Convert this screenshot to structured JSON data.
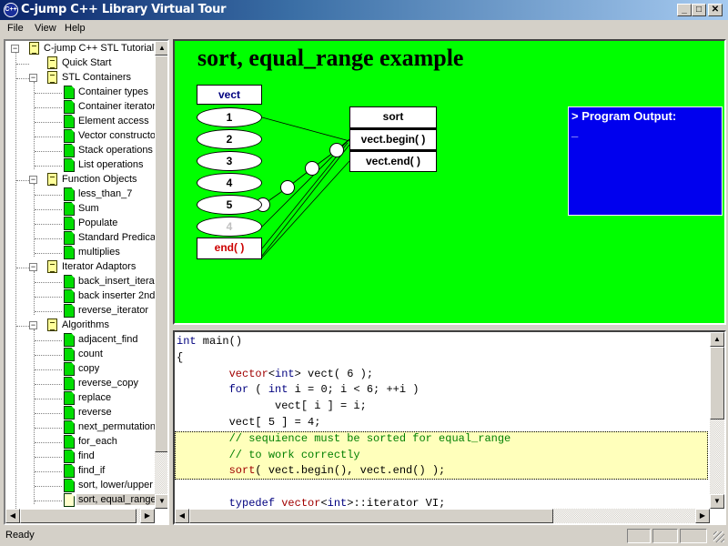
{
  "window": {
    "title": "C-jump C++ Library Virtual Tour",
    "controls": {
      "minimize": "_",
      "maximize": "□",
      "close": "✕"
    }
  },
  "menu": [
    "File",
    "View",
    "Help"
  ],
  "tree": {
    "root": "C-jump C++ STL Tutorial",
    "items": [
      {
        "label": "Quick Start",
        "type": "book",
        "level": 1
      },
      {
        "label": "STL Containers",
        "type": "book",
        "level": 1,
        "expanded": true
      },
      {
        "label": "Container types",
        "type": "page",
        "level": 2
      },
      {
        "label": "Container iterator",
        "type": "page",
        "level": 2
      },
      {
        "label": "Element access",
        "type": "page",
        "level": 2
      },
      {
        "label": "Vector constructo",
        "type": "page",
        "level": 2
      },
      {
        "label": "Stack operations",
        "type": "page",
        "level": 2
      },
      {
        "label": "List operations",
        "type": "page",
        "level": 2
      },
      {
        "label": "Function Objects",
        "type": "book",
        "level": 1,
        "expanded": true
      },
      {
        "label": "less_than_7",
        "type": "page",
        "level": 2
      },
      {
        "label": "Sum",
        "type": "page",
        "level": 2
      },
      {
        "label": "Populate",
        "type": "page",
        "level": 2
      },
      {
        "label": "Standard Predicat",
        "type": "page",
        "level": 2
      },
      {
        "label": "multiplies",
        "type": "page",
        "level": 2
      },
      {
        "label": "Iterator Adaptors",
        "type": "book",
        "level": 1,
        "expanded": true
      },
      {
        "label": "back_insert_iteral",
        "type": "page",
        "level": 2
      },
      {
        "label": "back inserter 2nd",
        "type": "page",
        "level": 2
      },
      {
        "label": "reverse_iterator",
        "type": "page",
        "level": 2
      },
      {
        "label": "Algorithms",
        "type": "book",
        "level": 1,
        "expanded": true
      },
      {
        "label": "adjacent_find",
        "type": "page",
        "level": 2
      },
      {
        "label": "count",
        "type": "page",
        "level": 2
      },
      {
        "label": "copy",
        "type": "page",
        "level": 2
      },
      {
        "label": "reverse_copy",
        "type": "page",
        "level": 2
      },
      {
        "label": "replace",
        "type": "page",
        "level": 2
      },
      {
        "label": "reverse",
        "type": "page",
        "level": 2
      },
      {
        "label": "next_permutation",
        "type": "page",
        "level": 2
      },
      {
        "label": "for_each",
        "type": "page",
        "level": 2
      },
      {
        "label": "find",
        "type": "page",
        "level": 2
      },
      {
        "label": "find_if",
        "type": "page",
        "level": 2
      },
      {
        "label": "sort, lower/upper",
        "type": "page",
        "level": 2
      },
      {
        "label": "sort, equal_range",
        "type": "current",
        "level": 2,
        "selected": true
      }
    ]
  },
  "diagram": {
    "title": "sort, equal_range example",
    "vector_label": "vect",
    "elements": [
      "1",
      "2",
      "3",
      "4",
      "5",
      "4"
    ],
    "end_label": "end( )",
    "function": {
      "name": "sort",
      "args": [
        "vect.begin( )",
        "vect.end( )"
      ]
    },
    "colors": {
      "background": "#00ff00",
      "vect_label": "#00007f",
      "end_label": "#cc0000",
      "dimmed_element": "#c0c0c0"
    }
  },
  "output": {
    "header": "> Program Output:",
    "cursor": "_"
  },
  "code": {
    "lines": [
      [
        {
          "t": "int",
          "c": "kw"
        },
        {
          "t": " main()"
        }
      ],
      [
        {
          "t": "{"
        }
      ],
      [
        {
          "t": "        "
        },
        {
          "t": "vector",
          "c": "ty"
        },
        {
          "t": "<"
        },
        {
          "t": "int",
          "c": "kw"
        },
        {
          "t": "> vect( 6 );"
        }
      ],
      [
        {
          "t": "        "
        },
        {
          "t": "for",
          "c": "kw"
        },
        {
          "t": " ( "
        },
        {
          "t": "int",
          "c": "kw"
        },
        {
          "t": " i = 0; i < 6; ++i )"
        }
      ],
      [
        {
          "t": "               vect[ i ] = i;"
        }
      ],
      [
        {
          "t": "        vect[ 5 ] = 4;"
        }
      ],
      [
        {
          "t": "        "
        },
        {
          "t": "// sequience must be sorted for equal_range",
          "c": "cm"
        }
      ],
      [
        {
          "t": "        "
        },
        {
          "t": "// to work correctly",
          "c": "cm"
        }
      ],
      [
        {
          "t": "        "
        },
        {
          "t": "sort",
          "c": "ty"
        },
        {
          "t": "( vect.begin(), vect.end() );"
        }
      ],
      [
        {
          "t": ""
        }
      ],
      [
        {
          "t": "        "
        },
        {
          "t": "typedef",
          "c": "kw"
        },
        {
          "t": " "
        },
        {
          "t": "vector",
          "c": "ty"
        },
        {
          "t": "<"
        },
        {
          "t": "int",
          "c": "kw"
        },
        {
          "t": ">::iterator VI;"
        }
      ]
    ]
  },
  "status": {
    "text": "Ready"
  }
}
